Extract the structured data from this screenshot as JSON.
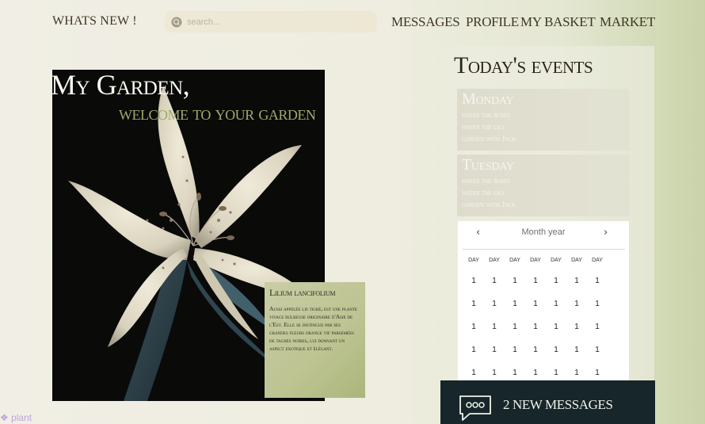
{
  "header": {
    "brand": "WHATS NEW !",
    "search_placeholder": "search...",
    "nav": [
      "MESSAGES",
      "PROFILE",
      "MY BASKET",
      "MARKET"
    ]
  },
  "hero": {
    "title": "My Garden,",
    "subtitle": "welcome to your garden"
  },
  "info_card": {
    "title": "Lilium lancifolium",
    "body": "Aussi appelée lis tigré, est une plante vivace bulbeuse originaire d'Asie de l'Est. Elle se distingue par ses grandes fleurs orange vif parsemées de taches noires, lui donnant un aspect exotique et élégant."
  },
  "events": {
    "title": "Today's events",
    "days": [
      {
        "name": "Monday",
        "tasks": [
          "water the roses",
          "water the lily",
          "garden with Jack"
        ]
      },
      {
        "name": "Tuesday",
        "tasks": [
          "water the roses",
          "water the lily",
          "garden with Jack"
        ]
      }
    ]
  },
  "calendar": {
    "header": "Month year",
    "prev_icon": "chevron-left-icon",
    "next_icon": "chevron-right-icon",
    "day_headers": [
      "DAY",
      "DAY",
      "DAY",
      "DAY",
      "DAY",
      "DAY",
      "DAY"
    ],
    "rows": [
      [
        "1",
        "1",
        "1",
        "1",
        "1",
        "1",
        "1"
      ],
      [
        "1",
        "1",
        "1",
        "1",
        "1",
        "1",
        "1"
      ],
      [
        "1",
        "1",
        "1",
        "1",
        "1",
        "1",
        "1"
      ],
      [
        "1",
        "1",
        "1",
        "1",
        "1",
        "1",
        "1"
      ],
      [
        "1",
        "1",
        "1",
        "1",
        "1",
        "1",
        "1"
      ]
    ]
  },
  "messages": {
    "label": "2 NEW MESSAGES",
    "icon": "chat-bubble-icon"
  },
  "footer": {
    "label": "plant"
  },
  "colors": {
    "accent_green": "#9eaa6a",
    "dark_panel": "#16262a",
    "text_dark": "#3f3526"
  }
}
